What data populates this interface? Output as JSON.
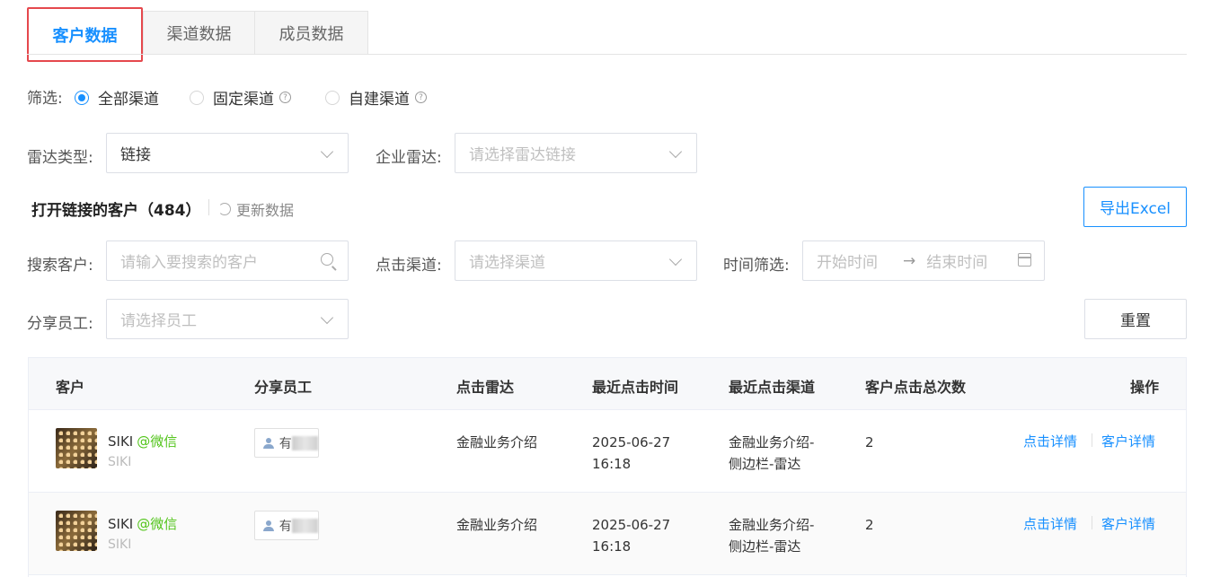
{
  "tabs": [
    {
      "label": "客户数据",
      "active": true
    },
    {
      "label": "渠道数据",
      "active": false
    },
    {
      "label": "成员数据",
      "active": false
    }
  ],
  "filter": {
    "label": "筛选:",
    "options": [
      {
        "label": "全部渠道",
        "checked": true
      },
      {
        "label": "固定渠道",
        "checked": false
      },
      {
        "label": "自建渠道",
        "checked": false
      }
    ]
  },
  "radar_type": {
    "label": "雷达类型:",
    "value": "链接"
  },
  "company_radar": {
    "label": "企业雷达:",
    "placeholder": "请选择雷达链接"
  },
  "section": {
    "title": "打开链接的客户（484）",
    "refresh_label": "更新数据",
    "export_label": "导出Excel"
  },
  "search_customer": {
    "label": "搜索客户:",
    "placeholder": "请输入要搜索的客户"
  },
  "click_channel": {
    "label": "点击渠道:",
    "placeholder": "请选择渠道"
  },
  "time_filter": {
    "label": "时间筛选:",
    "start_placeholder": "开始时间",
    "arrow": "→",
    "end_placeholder": "结束时间"
  },
  "share_employee": {
    "label": "分享员工:",
    "placeholder": "请选择员工"
  },
  "reset_label": "重置",
  "table": {
    "headers": [
      "客户",
      "分享员工",
      "点击雷达",
      "最近点击时间",
      "最近点击渠道",
      "客户点击总次数",
      "操作"
    ],
    "rows": [
      {
        "name": "SIKI",
        "source": "@微信",
        "sub": "SIKI",
        "employee_initial": "有",
        "radar": "金融业务介绍",
        "time_date": "2025-06-27",
        "time_clock": "16:18",
        "channel_line1": "金融业务介绍-",
        "channel_line2": "侧边栏-雷达",
        "count": "2",
        "action1": "点击详情",
        "action2": "客户详情"
      },
      {
        "name": "SIKI",
        "source": "@微信",
        "sub": "SIKI",
        "employee_initial": "有",
        "radar": "金融业务介绍",
        "time_date": "2025-06-27",
        "time_clock": "16:18",
        "channel_line1": "金融业务介绍-",
        "channel_line2": "侧边栏-雷达",
        "count": "2",
        "action1": "点击详情",
        "action2": "客户详情"
      }
    ]
  },
  "colors": {
    "accent": "#1890ff",
    "tab_highlight": "#e5484d",
    "wechat": "#52c41a"
  }
}
